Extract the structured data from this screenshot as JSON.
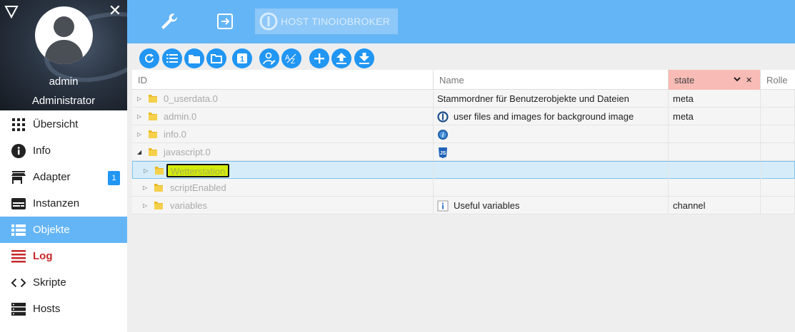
{
  "sidebar": {
    "username": "admin",
    "role": "Administrator",
    "items": [
      {
        "label": "Übersicht",
        "icon": "grid-icon"
      },
      {
        "label": "Info",
        "icon": "info-icon"
      },
      {
        "label": "Adapter",
        "icon": "store-icon",
        "badge": "1"
      },
      {
        "label": "Instanzen",
        "icon": "instances-icon"
      },
      {
        "label": "Objekte",
        "icon": "list-icon"
      },
      {
        "label": "Log",
        "icon": "log-icon"
      },
      {
        "label": "Skripte",
        "icon": "code-icon"
      },
      {
        "label": "Hosts",
        "icon": "server-icon"
      }
    ]
  },
  "header": {
    "host_label": "HOST TINOIOBROKER"
  },
  "table": {
    "columns": [
      "ID",
      "Name",
      "state",
      "Rolle"
    ],
    "rows": [
      {
        "id": "0_userdata.0",
        "name": "Stammordner für Benutzerobjekte und Dateien",
        "state": "meta"
      },
      {
        "id": "admin.0",
        "name": "user files and images for background image",
        "state": "meta"
      },
      {
        "id": "info.0",
        "name": "",
        "state": ""
      },
      {
        "id": "javascript.0",
        "name": "",
        "state": ""
      },
      {
        "id": "Wetterstation",
        "name": "",
        "state": ""
      },
      {
        "id": "scriptEnabled",
        "name": "",
        "state": ""
      },
      {
        "id": "variables",
        "name": "Useful variables",
        "state": "channel"
      }
    ]
  },
  "colors": {
    "accent": "#64b5f6",
    "button": "#2196f3",
    "log": "#c62828",
    "state_header": "#f8bbb5",
    "highlight": "#d4ed0c"
  }
}
